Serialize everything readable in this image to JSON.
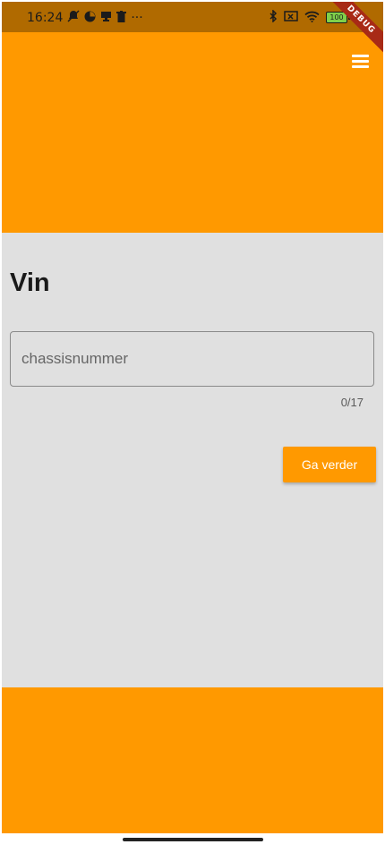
{
  "status_bar": {
    "time": "16:24",
    "overflow_dots": "···",
    "battery_level": "100",
    "left_icons": [
      "muted-notification-icon",
      "pie-chart-icon",
      "monitor-icon",
      "trash-icon"
    ],
    "right_icons": [
      "bluetooth-icon",
      "sim-card-icon",
      "wifi-icon",
      "battery-icon"
    ]
  },
  "debug_banner": {
    "label": "DEBUG"
  },
  "header": {
    "menu_icon": "hamburger-menu-icon"
  },
  "page": {
    "title": "Vin"
  },
  "vin_input": {
    "placeholder": "chassisnummer",
    "value": "",
    "counter": "0/17"
  },
  "submit": {
    "label": "Ga verder"
  },
  "colors": {
    "header": "#ff9900",
    "footer": "#ff9900",
    "content_background": "#e0e0e0",
    "status_bar": "#b06a00",
    "button": "#ff9900",
    "button_text": "#ffffff",
    "debug_banner": "#a82a16"
  }
}
